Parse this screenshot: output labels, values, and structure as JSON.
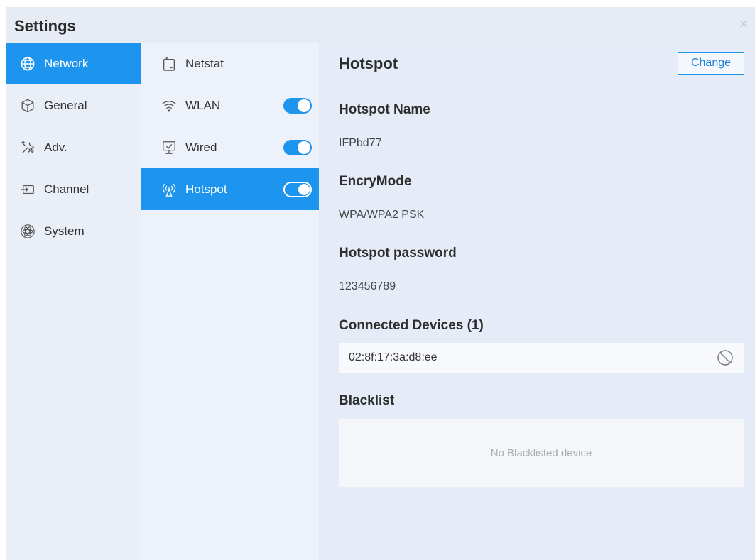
{
  "window": {
    "title": "Settings",
    "close_symbol": "×"
  },
  "nav_primary": [
    {
      "label": "Network",
      "icon": "globe-icon",
      "active": true
    },
    {
      "label": "General",
      "icon": "cube-icon",
      "active": false
    },
    {
      "label": "Adv.",
      "icon": "tools-icon",
      "active": false
    },
    {
      "label": "Channel",
      "icon": "input-channel-icon",
      "active": false
    },
    {
      "label": "System",
      "icon": "atom-icon",
      "active": false
    }
  ],
  "nav_secondary": [
    {
      "label": "Netstat",
      "icon": "netstat-icon",
      "toggle": null,
      "active": false
    },
    {
      "label": "WLAN",
      "icon": "wifi-icon",
      "toggle": true,
      "active": false
    },
    {
      "label": "Wired",
      "icon": "monitor-ethernet-icon",
      "toggle": true,
      "active": false
    },
    {
      "label": "Hotspot",
      "icon": "hotspot-antenna-icon",
      "toggle": true,
      "active": true
    }
  ],
  "main": {
    "title": "Hotspot",
    "change_label": "Change",
    "hotspot_name_label": "Hotspot Name",
    "hotspot_name_value": "IFPbd77",
    "encry_mode_label": "EncryMode",
    "encry_mode_value": "WPA/WPA2 PSK",
    "password_label": "Hotspot password",
    "password_value": "123456789",
    "connected_devices_label": "Connected Devices (1)",
    "connected_devices": [
      "02:8f:17:3a:d8:ee"
    ],
    "blacklist_label": "Blacklist",
    "blacklist_empty": "No Blacklisted device"
  },
  "colors": {
    "accent": "#1d95ee",
    "background": "#e9eef7"
  }
}
